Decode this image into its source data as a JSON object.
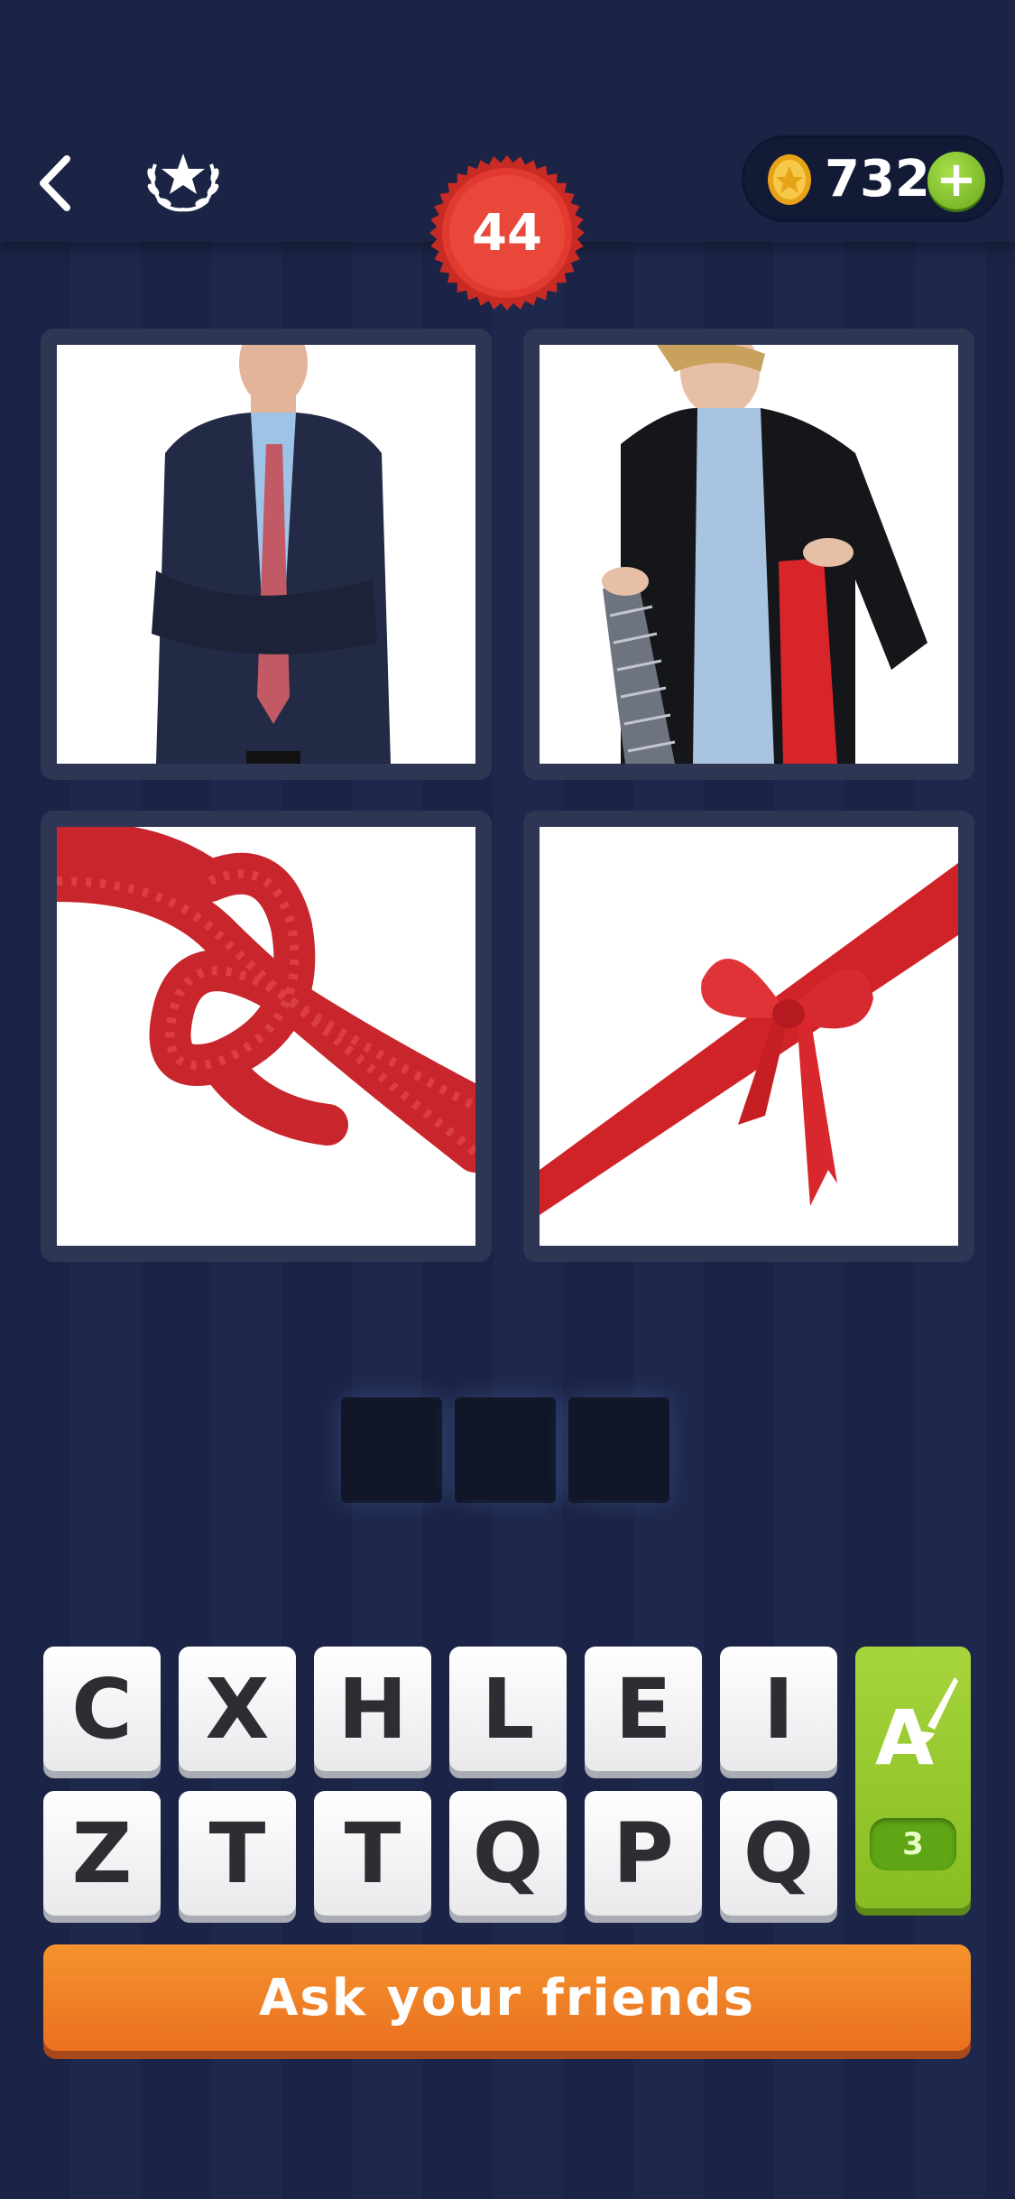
{
  "header": {
    "back_icon": "chevron-left-icon",
    "achievements_icon": "laurel-star-icon",
    "level": "44",
    "coins": "732",
    "add_coins_label": "+"
  },
  "pictures": [
    {
      "name": "man-in-suit-with-tie",
      "icon": "photo"
    },
    {
      "name": "man-holding-ties",
      "icon": "photo"
    },
    {
      "name": "red-rope-knot",
      "icon": "photo"
    },
    {
      "name": "red-ribbon-bow",
      "icon": "photo"
    }
  ],
  "answer": {
    "slots": [
      "",
      "",
      ""
    ]
  },
  "keyboard": {
    "row1": [
      "C",
      "X",
      "H",
      "L",
      "E",
      "I"
    ],
    "row2": [
      "Z",
      "T",
      "T",
      "Q",
      "P",
      "Q"
    ]
  },
  "hint": {
    "icon": "paint-brush-letter-icon",
    "count": "3"
  },
  "ask_button": {
    "label": "Ask your friends"
  },
  "colors": {
    "background": "#1a2344",
    "level_badge": "#e23a30",
    "hint_green": "#9ccc30",
    "ask_orange": "#f08326"
  }
}
